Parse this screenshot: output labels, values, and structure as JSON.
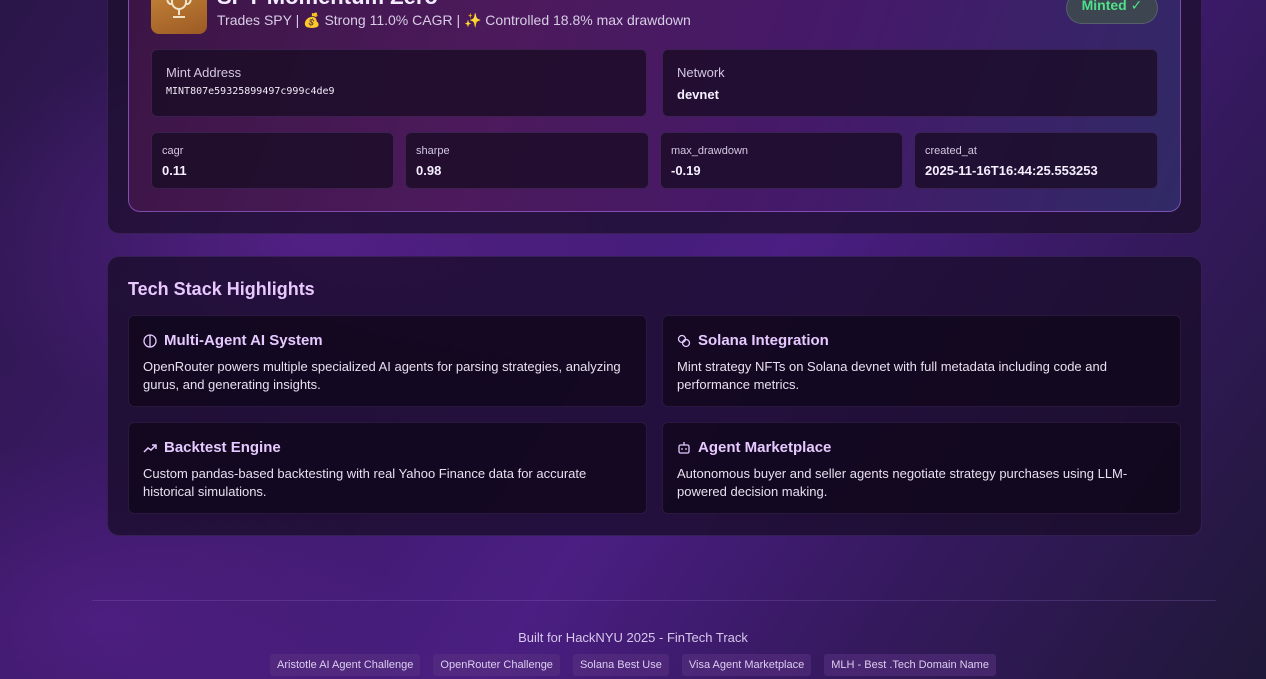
{
  "nft": {
    "title": "SPY Momentum Zero",
    "subtitle": "Trades SPY | 💰 Strong 11.0% CAGR | ✨ Controlled 18.8% max drawdown",
    "badge": "Minted ✓",
    "mint_address_label": "Mint Address",
    "mint_address": "MINT807e59325899497c999c4de9",
    "network_label": "Network",
    "network": "devnet",
    "stats": [
      {
        "label": "cagr",
        "value": "0.11"
      },
      {
        "label": "sharpe",
        "value": "0.98"
      },
      {
        "label": "max_drawdown",
        "value": "-0.19"
      },
      {
        "label": "created_at",
        "value": "2025-11-16T16:44:25.553253"
      }
    ]
  },
  "tech": {
    "heading": "Tech Stack Highlights",
    "cards": [
      {
        "icon": "brain-icon",
        "title": "Multi-Agent AI System",
        "desc": "OpenRouter powers multiple specialized AI agents for parsing strategies, analyzing gurus, and generating insights."
      },
      {
        "icon": "link-icon",
        "title": "Solana Integration",
        "desc": "Mint strategy NFTs on Solana devnet with full metadata including code and performance metrics."
      },
      {
        "icon": "trend-up-icon",
        "title": "Backtest Engine",
        "desc": "Custom pandas-based backtesting with real Yahoo Finance data for accurate historical simulations."
      },
      {
        "icon": "bot-icon",
        "title": "Agent Marketplace",
        "desc": "Autonomous buyer and seller agents negotiate strategy purchases using LLM-powered decision making."
      }
    ]
  },
  "footer": {
    "text": "Built for HackNYU 2025 - FinTech Track",
    "tags": [
      "Aristotle AI Agent Challenge",
      "OpenRouter Challenge",
      "Solana Best Use",
      "Visa Agent Marketplace",
      "MLH - Best .Tech Domain Name"
    ]
  },
  "colors": {
    "accent": "#e6c9ff",
    "success": "#4fe08a"
  }
}
